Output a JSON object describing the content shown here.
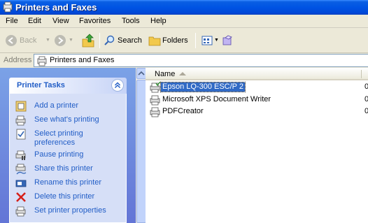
{
  "window": {
    "title": "Printers and Faxes"
  },
  "menu": [
    "File",
    "Edit",
    "View",
    "Favorites",
    "Tools",
    "Help"
  ],
  "toolbar": {
    "back": "Back",
    "search": "Search",
    "folders": "Folders"
  },
  "address": {
    "label": "Address",
    "value": "Printers and Faxes"
  },
  "tasks_panel": {
    "title": "Printer Tasks",
    "items": [
      {
        "label": "Add a printer",
        "icon": "add-printer-icon"
      },
      {
        "label": "See what's printing",
        "icon": "printer-queue-icon"
      },
      {
        "label": "Select printing\npreferences",
        "icon": "preferences-icon"
      },
      {
        "label": "Pause printing",
        "icon": "pause-printer-icon"
      },
      {
        "label": "Share this printer",
        "icon": "share-printer-icon"
      },
      {
        "label": "Rename this printer",
        "icon": "rename-icon"
      },
      {
        "label": "Delete this printer",
        "icon": "delete-icon"
      },
      {
        "label": "Set printer properties",
        "icon": "properties-icon"
      }
    ]
  },
  "list": {
    "column_name": "Name",
    "items": [
      {
        "name": "Epson LQ-300 ESC/P 2",
        "selected": true,
        "col2": "0"
      },
      {
        "name": "Microsoft XPS Document Writer",
        "selected": false,
        "col2": "0"
      },
      {
        "name": "PDFCreator",
        "selected": false,
        "col2": "0"
      }
    ]
  }
}
